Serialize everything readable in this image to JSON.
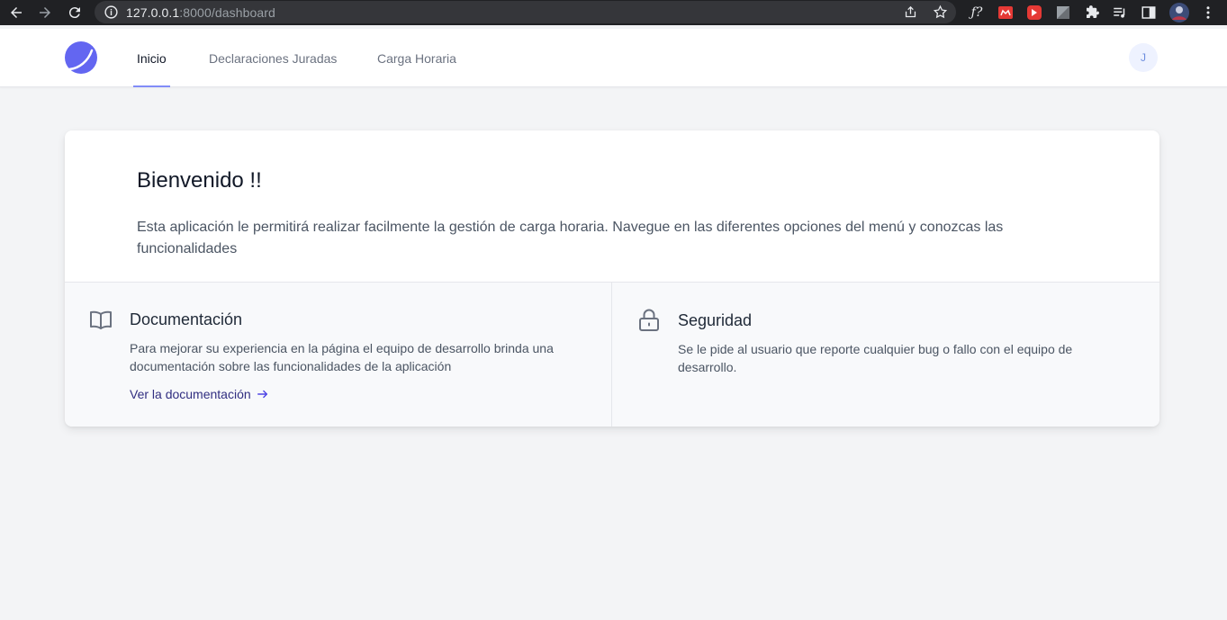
{
  "browser": {
    "url_host": "127.0.0.1",
    "url_rest": ":8000/dashboard"
  },
  "navbar": {
    "items": [
      {
        "label": "Inicio",
        "active": true
      },
      {
        "label": "Declaraciones Juradas",
        "active": false
      },
      {
        "label": "Carga Horaria",
        "active": false
      }
    ],
    "avatar_initial": "J"
  },
  "welcome": {
    "title": "Bienvenido !!",
    "text": "Esta aplicación le permitirá realizar facilmente la gestión de carga horaria. Navegue en las diferentes opciones del menú y conozcas las funcionalidades"
  },
  "features": {
    "documentation": {
      "icon": "book-icon",
      "title": "Documentación",
      "text": "Para mejorar su experiencia en la página el equipo de desarrollo brinda una documentación sobre las funcionalidades de la aplicación",
      "link_label": "Ver la documentación"
    },
    "security": {
      "icon": "lock-icon",
      "title": "Seguridad",
      "text": "Se le pide al usuario que reporte cualquier bug o fallo con el equipo de desarrollo."
    }
  },
  "colors": {
    "accent": "#818cf8",
    "logo": "#6366f1",
    "link": "#312e81"
  }
}
